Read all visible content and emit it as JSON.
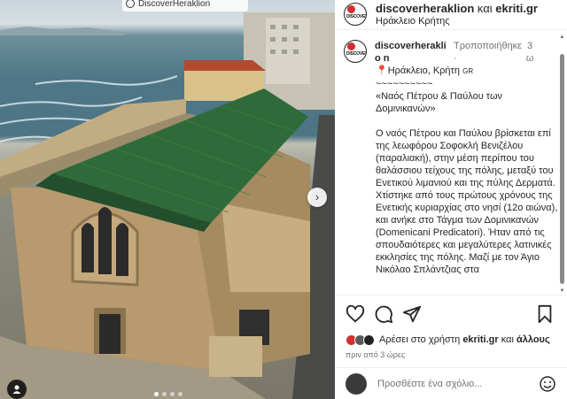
{
  "media": {
    "watermark": "DiscoverHeraklion",
    "next_icon": "chevron-right-icon",
    "user_icon": "user-tag-icon",
    "carousel_count": 4
  },
  "header": {
    "username": "discoverheraklion",
    "and": "και",
    "collaborator": "ekriti.gr",
    "location": "Ηράκλειο Κρήτης"
  },
  "caption": {
    "username": "discoverheraklio n",
    "edited": "Τροποποιήθηκε ·",
    "time": "3 ω",
    "location_line": "Ηράκλειο, Κρήτη",
    "location_badge": "GR",
    "squiggle": "~~~~~~~~~~",
    "title": "«Ναός Πέτρου & Παύλου των Δομινικανών»",
    "body": "Ο ναός Πέτρου και Παύλου βρίσκεται επί της λεωφόρου Σοφοκλή Βενιζέλου (παραλιακή), στην μέση περίπου του θαλάσσιου τείχους της πόλης, μεταξύ του Ενετικού λιμανιού και της πύλης Δερματά. Χτίστηκε από τους πρώτους χρόνους της Ενετικής κυριαρχίας στο νησί (12ο αιώνα), και ανήκε στο Τάγμα των Δομινικανών (Domenicani Predicatori). Ήταν από τις σπουδαιότερες και μεγαλύτερες λατινικές εκκλησίες της πόλης. Μαζί με τον Άγιο Νικόλαο Σπλάντζιας στα"
  },
  "actions": {
    "like_icon": "heart-icon",
    "comment_icon": "comment-icon",
    "share_icon": "send-icon",
    "save_icon": "bookmark-icon",
    "likes_prefix": "Αρέσει στο χρήστη",
    "likes_user": "ekriti.gr",
    "likes_and": "και",
    "likes_others": "άλλους",
    "time_ago": "πριν από 3 ώρες"
  },
  "comment": {
    "placeholder": "Προσθέστε ένα σχόλιο...",
    "emoji_icon": "smiley-icon"
  },
  "colors": {
    "roof": "#2f6b3a",
    "stone": "#b89a6e",
    "sea": "#4e7686",
    "text": "#262626",
    "muted": "#737373"
  }
}
